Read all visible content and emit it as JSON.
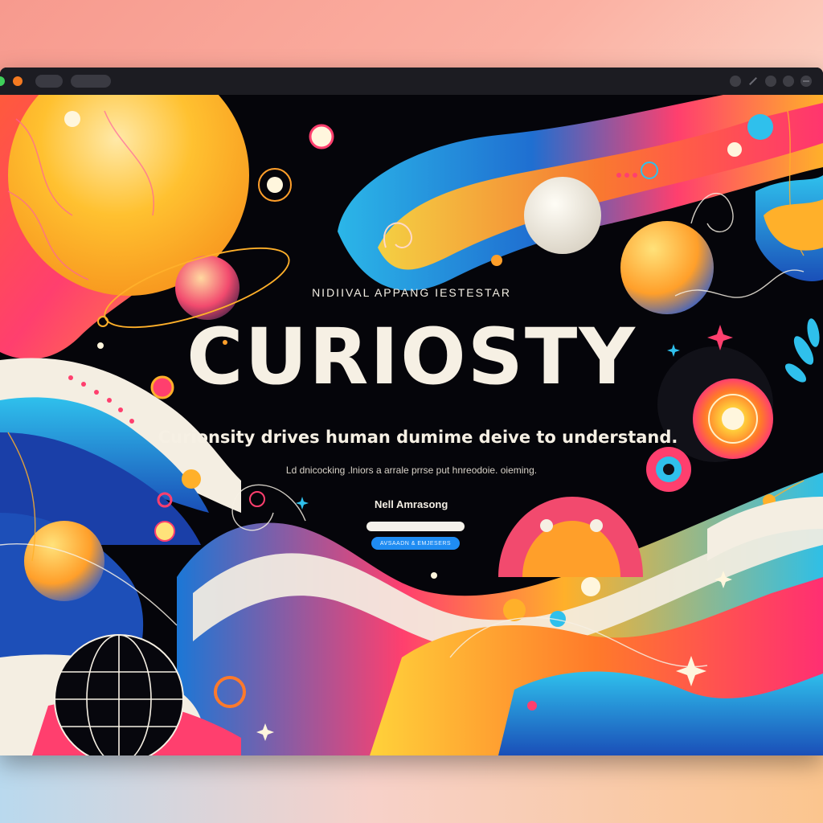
{
  "window": {
    "tabs": [
      "",
      ""
    ],
    "controls": [
      "back-icon",
      "close-icon",
      "circle-icon",
      "circle-icon",
      "minimize-icon"
    ]
  },
  "hero": {
    "eyebrow": "NIDIIVAL APPANG IESTESTAR",
    "title": "CURIOSTY",
    "subtitle": "Curionsity drives human dumime deive to understand.",
    "tagline": "Ld dnicocking .lniors a arrale prrse put hnreodoie. oieming.",
    "author": "Nell Amrasong",
    "input_value": "",
    "cta_label": "AVSAADN & EMJESERS"
  },
  "colors": {
    "background_top": "#f79a8e",
    "window_bar": "#1c1c22",
    "canvas": "#05050a",
    "accent_orange": "#f7a21b",
    "accent_pink": "#f0386b",
    "accent_blue": "#1f8cf2",
    "accent_cyan": "#35c0e8",
    "cream": "#f6f0e4"
  }
}
